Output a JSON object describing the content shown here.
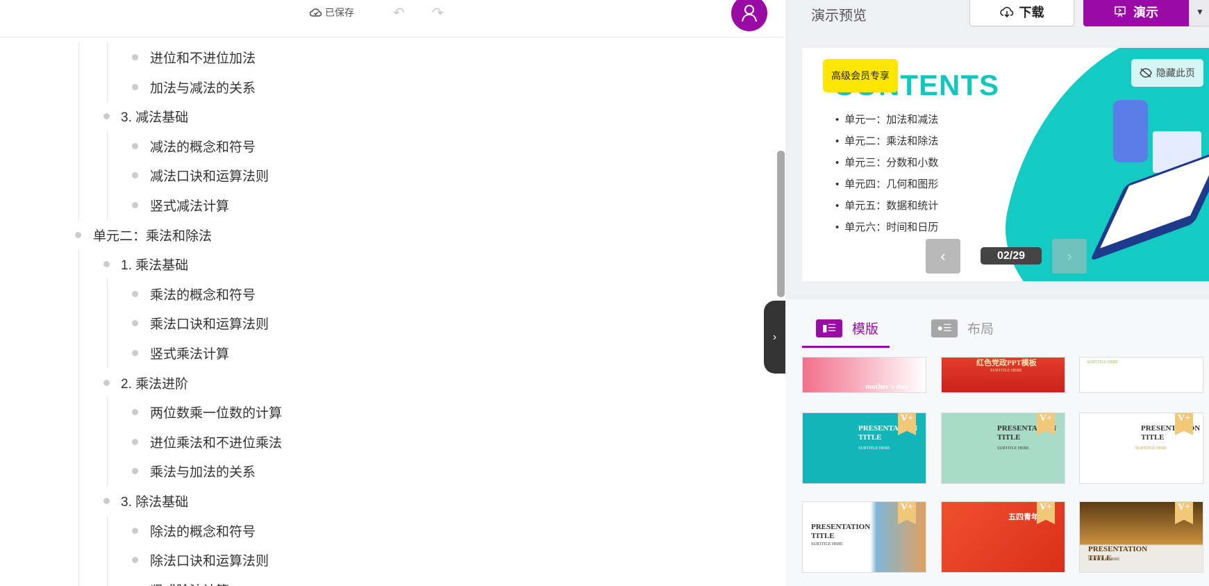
{
  "header": {
    "saved_label": "已保存",
    "undo_icon": "↶",
    "redo_icon": "↷"
  },
  "outline": [
    {
      "level": 3,
      "text": "进位和不进位加法"
    },
    {
      "level": 3,
      "text": "加法与减法的关系"
    },
    {
      "level": 2,
      "text": "3. 减法基础"
    },
    {
      "level": 3,
      "text": "减法的概念和符号"
    },
    {
      "level": 3,
      "text": "减法口诀和运算法则"
    },
    {
      "level": 3,
      "text": "竖式减法计算"
    },
    {
      "level": 1,
      "text": "单元二：乘法和除法"
    },
    {
      "level": 2,
      "text": "1. 乘法基础"
    },
    {
      "level": 3,
      "text": "乘法的概念和符号"
    },
    {
      "level": 3,
      "text": "乘法口诀和运算法则"
    },
    {
      "level": 3,
      "text": "竖式乘法计算"
    },
    {
      "level": 2,
      "text": "2. 乘法进阶"
    },
    {
      "level": 3,
      "text": "两位数乘一位数的计算"
    },
    {
      "level": 3,
      "text": "进位乘法和不进位乘法"
    },
    {
      "level": 3,
      "text": "乘法与加法的关系"
    },
    {
      "level": 2,
      "text": "3. 除法基础"
    },
    {
      "level": 3,
      "text": "除法的概念和符号"
    },
    {
      "level": 3,
      "text": "除法口诀和运算法则"
    },
    {
      "level": 3,
      "text": "竖式除法计算"
    }
  ],
  "right": {
    "title": "演示预览",
    "download_label": "下载",
    "present_label": "演示",
    "slide": {
      "badge": "高级会员专享",
      "heading": "CONTENTS",
      "hide_label": "隐藏此页",
      "page": "02/29",
      "toc": [
        "单元一：加法和减法",
        "单元二：乘法和除法",
        "单元三：分数和小数",
        "单元四：几何和图形",
        "单元五：数据和统计",
        "单元六：时间和日历"
      ]
    },
    "tabs": [
      {
        "label": "模版",
        "active": true
      },
      {
        "label": "布局",
        "active": false
      }
    ],
    "templates": [
      {
        "title": "mother's day",
        "subtitle": "",
        "bg": "linear-gradient(90deg,#f26f8a,#fbd3dc 70%,#fff)",
        "color": "#fff",
        "vip": false
      },
      {
        "title": "红色党政PPT模板",
        "subtitle": "SUBTITLE HERE",
        "bg": "linear-gradient(180deg,#e53b2c,#c8231b)",
        "color": "#ffe3b0",
        "vip": false
      },
      {
        "title": "",
        "subtitle": "SUBTITLE HERE",
        "bg": "#fff",
        "color": "#8bc34a",
        "vip": false
      },
      {
        "title": "PRESENTATION TITLE",
        "subtitle": "SUBTITLE HERE",
        "bg": "#12b5b8",
        "color": "#fff",
        "vip": true
      },
      {
        "title": "PRESENTATION TITLE",
        "subtitle": "SUBTITLE HERE",
        "bg": "#a9dcc8",
        "color": "#333",
        "vip": true
      },
      {
        "title": "PRESENTATION TITLE",
        "subtitle": "SUBTITLE HERE",
        "bg": "#fff",
        "color": "#333",
        "vip": true
      },
      {
        "title": "PRESENTATION TITLE",
        "subtitle": "SUBTITLE HERE",
        "bg": "linear-gradient(90deg,#fff 55%,#7fb7d6 60%,#e0a060)",
        "color": "#333",
        "vip": true
      },
      {
        "title": "五四青年节",
        "subtitle": "",
        "bg": "linear-gradient(135deg,#f0502e,#d92f1a)",
        "color": "#fff",
        "vip": true
      },
      {
        "title": "PRESENTATION TITLE",
        "subtitle": "SUBTITLE HERE",
        "bg": "linear-gradient(180deg,#5a3b12 0,#c99040 60%,#eeeae4 62%)",
        "color": "#5a3b12",
        "vip": true
      }
    ],
    "vip_label": "V+"
  }
}
